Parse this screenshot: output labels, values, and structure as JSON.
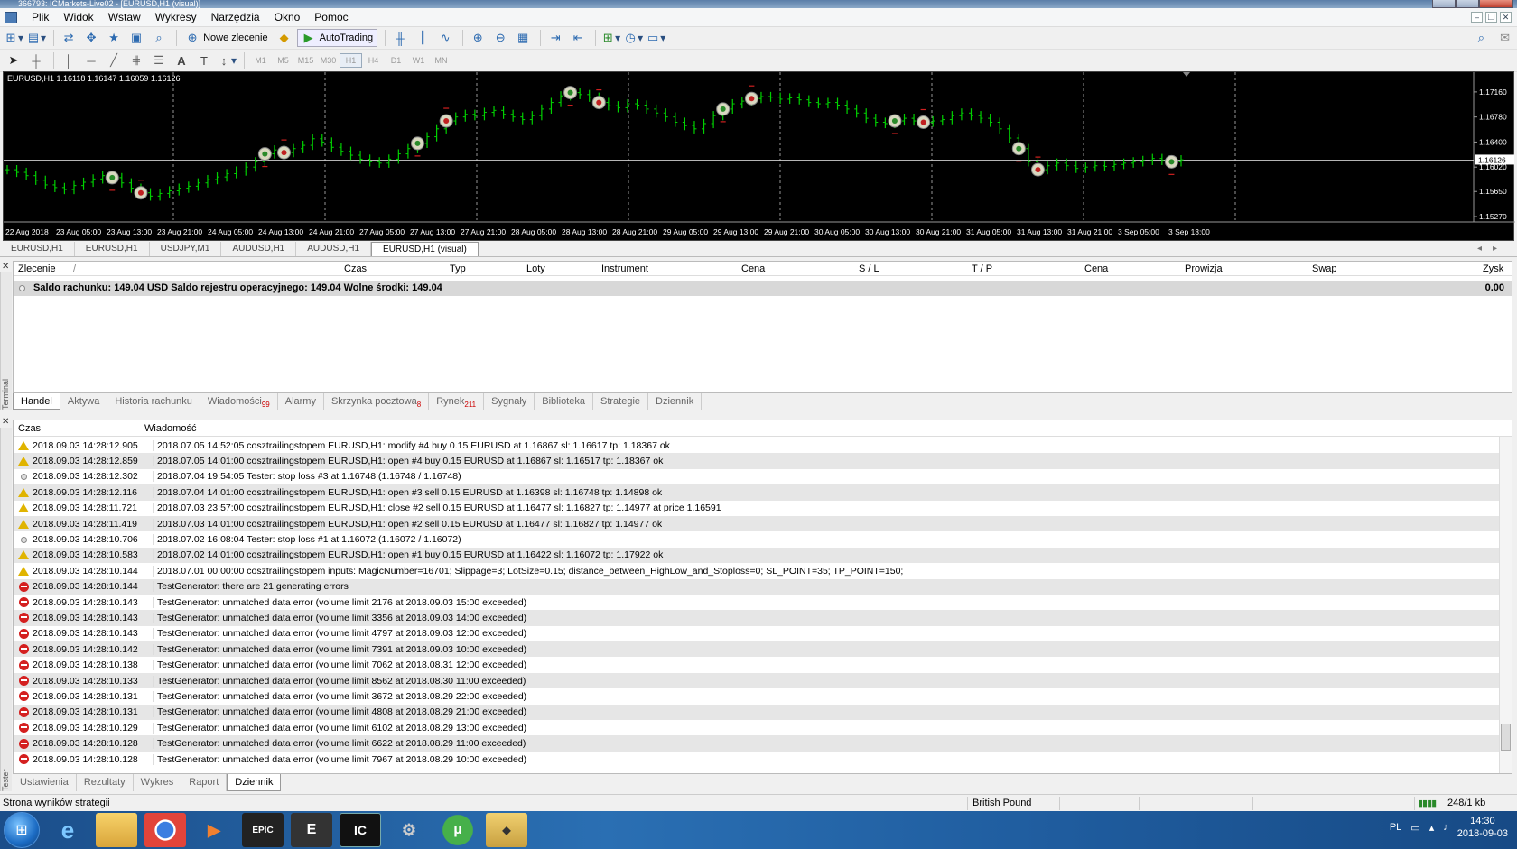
{
  "window": {
    "title": "366793: ICMarkets-Live02 - [EURUSD,H1 (visual)]"
  },
  "menu": [
    "Plik",
    "Widok",
    "Wstaw",
    "Wykresy",
    "Narzędzia",
    "Okno",
    "Pomoc"
  ],
  "toolbar": {
    "new_order": "Nowe zlecenie",
    "autotrading": "AutoTrading"
  },
  "timeframes": [
    "M1",
    "M5",
    "M15",
    "M30",
    "H1",
    "H4",
    "D1",
    "W1",
    "MN"
  ],
  "selected_timeframe": "H1",
  "chart_tabs": [
    "EURUSD,H1",
    "EURUSD,H1",
    "USDJPY,M1",
    "AUDUSD,H1",
    "AUDUSD,H1",
    "EURUSD,H1 (visual)"
  ],
  "active_chart_tab": 5,
  "chart_data": {
    "type": "line",
    "header": "EURUSD,H1  1.16118 1.16147 1.16059 1.16126",
    "y_ticks": [
      "1.17160",
      "1.16780",
      "1.16400",
      "1.16020",
      "1.15650",
      "1.15270"
    ],
    "current_price": "1.16126",
    "ylim": [
      1.1527,
      1.1735
    ],
    "x_labels": [
      "22 Aug 2018",
      "23 Aug 05:00",
      "23 Aug 13:00",
      "23 Aug 21:00",
      "24 Aug 05:00",
      "24 Aug 13:00",
      "24 Aug 21:00",
      "27 Aug 05:00",
      "27 Aug 13:00",
      "27 Aug 21:00",
      "28 Aug 05:00",
      "28 Aug 13:00",
      "28 Aug 21:00",
      "29 Aug 05:00",
      "29 Aug 13:00",
      "29 Aug 21:00",
      "30 Aug 05:00",
      "30 Aug 13:00",
      "30 Aug 21:00",
      "31 Aug 05:00",
      "31 Aug 13:00",
      "31 Aug 21:00",
      "3 Sep 05:00",
      "3 Sep 13:00"
    ],
    "closes": [
      1.1598,
      1.1594,
      1.1589,
      1.1582,
      1.1575,
      1.1571,
      1.1568,
      1.1574,
      1.1579,
      1.1584,
      1.1589,
      1.1586,
      1.1578,
      1.157,
      1.1563,
      1.1558,
      1.1562,
      1.1566,
      1.157,
      1.1573,
      1.1578,
      1.1583,
      1.1587,
      1.1592,
      1.1596,
      1.1602,
      1.161,
      1.1622,
      1.1628,
      1.1624,
      1.163,
      1.1635,
      1.1645,
      1.164,
      1.1632,
      1.1626,
      1.162,
      1.1614,
      1.161,
      1.1608,
      1.1614,
      1.1622,
      1.163,
      1.1638,
      1.1648,
      1.166,
      1.1672,
      1.1678,
      1.1682,
      1.168,
      1.1685,
      1.1688,
      1.1682,
      1.1678,
      1.1674,
      1.168,
      1.169,
      1.17,
      1.171,
      1.1715,
      1.1712,
      1.1708,
      1.17,
      1.1695,
      1.1692,
      1.1698,
      1.1696,
      1.169,
      1.1684,
      1.1678,
      1.167,
      1.1665,
      1.166,
      1.1668,
      1.168,
      1.169,
      1.1698,
      1.1702,
      1.1706,
      1.1709,
      1.1708,
      1.1705,
      1.1707,
      1.1704,
      1.17,
      1.1698,
      1.17,
      1.1696,
      1.169,
      1.1684,
      1.1676,
      1.167,
      1.1668,
      1.1672,
      1.1676,
      1.1672,
      1.167,
      1.1672,
      1.1674,
      1.168,
      1.1684,
      1.168,
      1.1676,
      1.167,
      1.166,
      1.1646,
      1.163,
      1.161,
      1.1598,
      1.1604,
      1.1608,
      1.1604,
      1.16,
      1.1602,
      1.1604,
      1.1603,
      1.1606,
      1.1608,
      1.161,
      1.1612,
      1.1615,
      1.1612,
      1.161,
      1.1613
    ],
    "markers": [
      {
        "i": 11,
        "type": "buy"
      },
      {
        "i": 14,
        "type": "sell"
      },
      {
        "i": 27,
        "type": "buy"
      },
      {
        "i": 29,
        "type": "sell"
      },
      {
        "i": 43,
        "type": "buy"
      },
      {
        "i": 46,
        "type": "sell"
      },
      {
        "i": 59,
        "type": "buy"
      },
      {
        "i": 62,
        "type": "sell"
      },
      {
        "i": 75,
        "type": "buy"
      },
      {
        "i": 78,
        "type": "sell"
      },
      {
        "i": 93,
        "type": "buy"
      },
      {
        "i": 96,
        "type": "sell"
      },
      {
        "i": 106,
        "type": "buy"
      },
      {
        "i": 108,
        "type": "sell"
      },
      {
        "i": 122,
        "type": "buy"
      }
    ]
  },
  "terminal": {
    "side_label": "Terminal",
    "columns": [
      "Zlecenie",
      "Czas",
      "Typ",
      "Loty",
      "Instrument",
      "Cena",
      "S / L",
      "T / P",
      "Cena",
      "Prowizja",
      "Swap",
      "Zysk"
    ],
    "balance": "Saldo rachunku: 149.04 USD  Saldo rejestru operacyjnego: 149.04  Wolne środki: 149.04",
    "profit": "0.00",
    "tabs": [
      {
        "label": "Handel",
        "badge": ""
      },
      {
        "label": "Aktywa",
        "badge": ""
      },
      {
        "label": "Historia rachunku",
        "badge": ""
      },
      {
        "label": "Wiadomości",
        "badge": "99"
      },
      {
        "label": "Alarmy",
        "badge": ""
      },
      {
        "label": "Skrzynka pocztowa",
        "badge": "8"
      },
      {
        "label": "Rynek",
        "badge": "211"
      },
      {
        "label": "Sygnały",
        "badge": ""
      },
      {
        "label": "Biblioteka",
        "badge": ""
      },
      {
        "label": "Strategie",
        "badge": ""
      },
      {
        "label": "Dziennik",
        "badge": ""
      }
    ],
    "active_tab": 0
  },
  "journal": {
    "side_label": "Tester",
    "col_time": "Czas",
    "col_message": "Wiadomość",
    "rows": [
      {
        "icon": "warn",
        "time": "2018.09.03 14:28:12.905",
        "msg": "2018.07.05 14:52:05  cosztrailingstopem EURUSD,H1: modify #4 buy 0.15 EURUSD at 1.16867 sl: 1.16617 tp: 1.18367 ok"
      },
      {
        "icon": "warn",
        "time": "2018.09.03 14:28:12.859",
        "msg": "2018.07.05 14:01:00  cosztrailingstopem EURUSD,H1: open #4 buy 0.15 EURUSD at 1.16867 sl: 1.16517 tp: 1.18367 ok"
      },
      {
        "icon": "info",
        "time": "2018.09.03 14:28:12.302",
        "msg": "2018.07.04 19:54:05  Tester: stop loss #3 at 1.16748 (1.16748 / 1.16748)"
      },
      {
        "icon": "warn",
        "time": "2018.09.03 14:28:12.116",
        "msg": "2018.07.04 14:01:00  cosztrailingstopem EURUSD,H1: open #3 sell 0.15 EURUSD at 1.16398 sl: 1.16748 tp: 1.14898 ok"
      },
      {
        "icon": "warn",
        "time": "2018.09.03 14:28:11.721",
        "msg": "2018.07.03 23:57:00  cosztrailingstopem EURUSD,H1: close #2 sell 0.15 EURUSD at 1.16477 sl: 1.16827 tp: 1.14977 at price 1.16591"
      },
      {
        "icon": "warn",
        "time": "2018.09.03 14:28:11.419",
        "msg": "2018.07.03 14:01:00  cosztrailingstopem EURUSD,H1: open #2 sell 0.15 EURUSD at 1.16477 sl: 1.16827 tp: 1.14977 ok"
      },
      {
        "icon": "info",
        "time": "2018.09.03 14:28:10.706",
        "msg": "2018.07.02 16:08:04  Tester: stop loss #1 at 1.16072 (1.16072 / 1.16072)"
      },
      {
        "icon": "warn",
        "time": "2018.09.03 14:28:10.583",
        "msg": "2018.07.02 14:01:00  cosztrailingstopem EURUSD,H1: open #1 buy 0.15 EURUSD at 1.16422 sl: 1.16072 tp: 1.17922 ok"
      },
      {
        "icon": "warn",
        "time": "2018.09.03 14:28:10.144",
        "msg": "2018.07.01 00:00:00  cosztrailingstopem inputs: MagicNumber=16701; Slippage=3; LotSize=0.15; distance_between_HighLow_and_Stoploss=0; SL_POINT=35; TP_POINT=150;"
      },
      {
        "icon": "err",
        "time": "2018.09.03 14:28:10.144",
        "msg": "TestGenerator: there are 21 generating errors"
      },
      {
        "icon": "err",
        "time": "2018.09.03 14:28:10.143",
        "msg": "TestGenerator: unmatched data error (volume limit 2176 at 2018.09.03 15:00 exceeded)"
      },
      {
        "icon": "err",
        "time": "2018.09.03 14:28:10.143",
        "msg": "TestGenerator: unmatched data error (volume limit 3356 at 2018.09.03 14:00 exceeded)"
      },
      {
        "icon": "err",
        "time": "2018.09.03 14:28:10.143",
        "msg": "TestGenerator: unmatched data error (volume limit 4797 at 2018.09.03 12:00 exceeded)"
      },
      {
        "icon": "err",
        "time": "2018.09.03 14:28:10.142",
        "msg": "TestGenerator: unmatched data error (volume limit 7391 at 2018.09.03 10:00 exceeded)"
      },
      {
        "icon": "err",
        "time": "2018.09.03 14:28:10.138",
        "msg": "TestGenerator: unmatched data error (volume limit 7062 at 2018.08.31 12:00 exceeded)"
      },
      {
        "icon": "err",
        "time": "2018.09.03 14:28:10.133",
        "msg": "TestGenerator: unmatched data error (volume limit 8562 at 2018.08.30 11:00 exceeded)"
      },
      {
        "icon": "err",
        "time": "2018.09.03 14:28:10.131",
        "msg": "TestGenerator: unmatched data error (volume limit 3672 at 2018.08.29 22:00 exceeded)"
      },
      {
        "icon": "err",
        "time": "2018.09.03 14:28:10.131",
        "msg": "TestGenerator: unmatched data error (volume limit 4808 at 2018.08.29 21:00 exceeded)"
      },
      {
        "icon": "err",
        "time": "2018.09.03 14:28:10.129",
        "msg": "TestGenerator: unmatched data error (volume limit 6102 at 2018.08.29 13:00 exceeded)"
      },
      {
        "icon": "err",
        "time": "2018.09.03 14:28:10.128",
        "msg": "TestGenerator: unmatched data error (volume limit 6622 at 2018.08.29 11:00 exceeded)"
      },
      {
        "icon": "err",
        "time": "2018.09.03 14:28:10.128",
        "msg": "TestGenerator: unmatched data error (volume limit 7967 at 2018.08.29 10:00 exceeded)"
      }
    ]
  },
  "tester_tabs": [
    "Ustawienia",
    "Rezultaty",
    "Wykres",
    "Raport",
    "Dziennik"
  ],
  "active_tester_tab": 4,
  "status": {
    "left": "Strona wyników strategii",
    "profile": "British Pound",
    "traffic": "248/1 kb"
  },
  "taskbar": {
    "lang": "PL",
    "time": "14:30",
    "date": "2018-09-03"
  }
}
